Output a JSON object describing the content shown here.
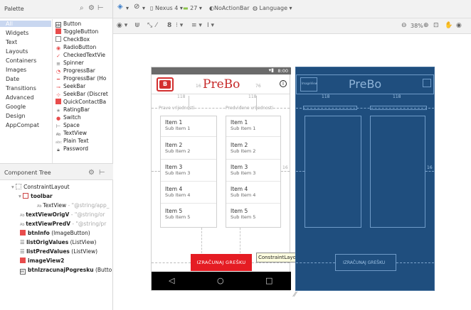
{
  "palette": {
    "title": "Palette",
    "categories": [
      "All",
      "Widgets",
      "Text",
      "Layouts",
      "Containers",
      "Images",
      "Date",
      "Transitions",
      "Advanced",
      "Google",
      "Design",
      "AppCompat"
    ],
    "widgets": [
      {
        "label": "Button",
        "icon": "button-icon"
      },
      {
        "label": "ToggleButton",
        "icon": "toggle-button-icon"
      },
      {
        "label": "CheckBox",
        "icon": "checkbox-icon"
      },
      {
        "label": "RadioButton",
        "icon": "radio-button-icon"
      },
      {
        "label": "CheckedTextVie",
        "icon": "checked-text-view-icon"
      },
      {
        "label": "Spinner",
        "icon": "spinner-icon"
      },
      {
        "label": "ProgressBar",
        "icon": "progress-bar-icon"
      },
      {
        "label": "ProgressBar (Ho",
        "icon": "progress-bar-horizontal-icon"
      },
      {
        "label": "SeekBar",
        "icon": "seekbar-icon"
      },
      {
        "label": "SeekBar (Discret",
        "icon": "seekbar-discrete-icon"
      },
      {
        "label": "QuickContactBa",
        "icon": "quick-contact-badge-icon"
      },
      {
        "label": "RatingBar",
        "icon": "rating-bar-icon"
      },
      {
        "label": "Switch",
        "icon": "switch-icon"
      },
      {
        "label": "Space",
        "icon": "space-icon"
      },
      {
        "label": "TextView",
        "icon": "textview-icon"
      },
      {
        "label": "Plain Text",
        "icon": "plain-text-icon"
      },
      {
        "label": "Password",
        "icon": "password-icon"
      }
    ]
  },
  "toolbar": {
    "device": "Nexus 4",
    "api": "27",
    "theme": "NoActionBar",
    "language": "Language",
    "zoom": "38%"
  },
  "tree": {
    "title": "Component Tree",
    "root": "ConstraintLayout",
    "toolbar": "toolbar",
    "toolbar_child": "TextView",
    "toolbar_child_ref": "- \"@string/app_",
    "items": [
      {
        "name": "textViewOrigV",
        "ref": "- \"@string/or"
      },
      {
        "name": "textViewPredV",
        "ref": "- \"@string/pr"
      }
    ],
    "btn_info": "btnInfo",
    "btn_info_type": "(ImageButton)",
    "list_orig": "listOrigValues",
    "list_orig_type": "(ListView)",
    "list_pred": "listPredValues",
    "list_pred_type": "(ListView)",
    "image2": "imageView2",
    "btn_calc": "btnIzracunajPogresku",
    "btn_calc_type": "(Butto"
  },
  "design": {
    "status_time": "8:00",
    "app_title": "PreBo",
    "logo_text": "B",
    "label_orig": "Prave vrijednosti",
    "label_pred": "Predviđene vrijednosti",
    "list_items": [
      {
        "title": "Item 1",
        "sub": "Sub Item 1"
      },
      {
        "title": "Item 2",
        "sub": "Sub Item 2"
      },
      {
        "title": "Item 3",
        "sub": "Sub Item 3"
      },
      {
        "title": "Item 4",
        "sub": "Sub Item 4"
      },
      {
        "title": "Item 5",
        "sub": "Sub Item 5"
      }
    ],
    "button_label": "IZRAČUNAJ GREŠKU",
    "margin_118": "118",
    "margin_16": "16",
    "margin_76": "76"
  },
  "blueprint": {
    "app_title": "PreBo",
    "button_label": "IZRAČUNAJ GREŠKU",
    "tag": "ImageView"
  },
  "tooltip": "ConstraintLayout"
}
